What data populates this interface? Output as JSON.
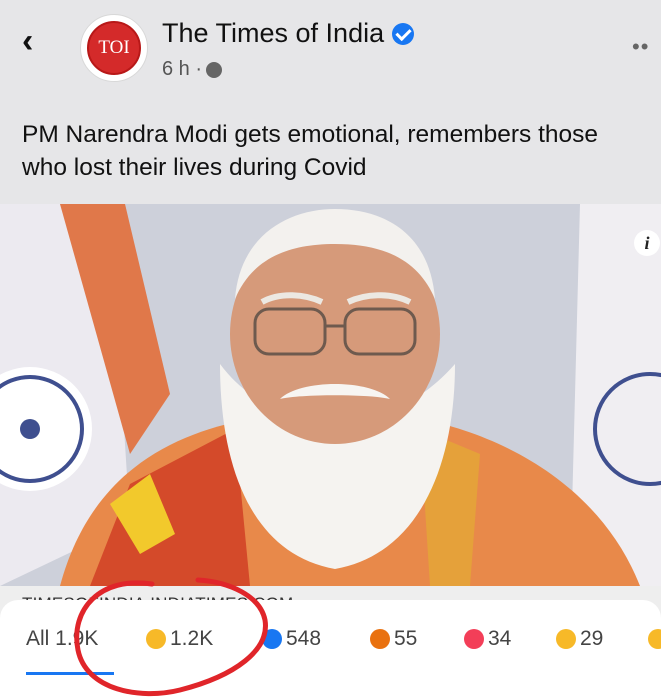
{
  "header": {
    "page_name": "The Times of India",
    "avatar_text": "TOI",
    "time": "6 h ·",
    "icons": {
      "back": "back-arrow-icon",
      "verified": "verified-badge-icon",
      "globe": "globe-icon",
      "more": "more-options-icon"
    }
  },
  "post": {
    "headline": "PM Narendra Modi gets emotional, remembers those who lost their lives during Covid",
    "info_badge": "i",
    "link_domain": "TIMESOFINDIA.INDIATIMES.COM"
  },
  "reactions": {
    "all_label": "All 1.9K",
    "items": [
      {
        "icon": "haha-emoji-icon",
        "count": "1.2K",
        "color": "#f7b928"
      },
      {
        "icon": "like-icon",
        "count": "548",
        "color": "#1877f2"
      },
      {
        "icon": "angry-emoji-icon",
        "count": "55",
        "color": "#e9710f"
      },
      {
        "icon": "love-icon",
        "count": "34",
        "color": "#f33e58"
      },
      {
        "icon": "sad-emoji-icon",
        "count": "29",
        "color": "#f7b928"
      }
    ]
  },
  "colors": {
    "accent": "#1877f2",
    "annotation": "#e0252a",
    "toi_red": "#d42a2a"
  }
}
